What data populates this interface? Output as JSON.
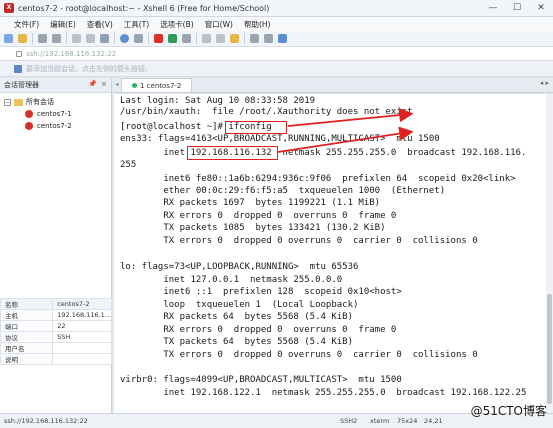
{
  "window": {
    "title": "centos7-2 - root@localhost:~ - Xshell 6 (Free for Home/School)",
    "icon_label": "X",
    "controls": [
      "—",
      "☐",
      "✕"
    ]
  },
  "menu": [
    "文件(F)",
    "编辑(E)",
    "查看(V)",
    "工具(T)",
    "选项卡(B)",
    "窗口(W)",
    "帮助(H)"
  ],
  "address": {
    "value": "ssh://192.168.116.132:22"
  },
  "hint": {
    "text": "要添加当前会话，点击左侧的箭头按钮。"
  },
  "session_manager": {
    "header": "会话管理器",
    "pin_icon": "📌",
    "close_icon": "×",
    "root_label": "所有会话",
    "expander": "−",
    "sessions": [
      {
        "label": "centos7-1"
      },
      {
        "label": "centos7-2"
      }
    ]
  },
  "properties": {
    "header_key": "名称",
    "header_value": "centos7-2",
    "rows": [
      {
        "key": "主机",
        "value": "192.168.116.1..."
      },
      {
        "key": "端口",
        "value": "22"
      },
      {
        "key": "协议",
        "value": "SSH"
      },
      {
        "key": "用户名",
        "value": ""
      },
      {
        "key": "说明",
        "value": ""
      }
    ]
  },
  "tabs": [
    {
      "label": "1 centos7-2"
    }
  ],
  "tab_nav_left": "◂",
  "tab_nav_right": "◂ ▸",
  "terminal": {
    "lines": [
      "Last login: Sat Aug 10 08:33:58 2019",
      "/usr/bin/xauth:  file /root/.Xauthority does not exist",
      "[root@localhost ~]# ifconfig",
      "ens33: flags=4163<UP,BROADCAST,RUNNING,MULTICAST>  mtu 1500",
      "        inet 192.168.116.132  netmask 255.255.255.0  broadcast 192.168.116.",
      "255",
      "        inet6 fe80::1a6b:6294:936c:9f06  prefixlen 64  scopeid 0x20<link>",
      "        ether 00:0c:29:f6:f5:a5  txqueuelen 1000  (Ethernet)",
      "        RX packets 1697  bytes 1199221 (1.1 MiB)",
      "        RX errors 0  dropped 0  overruns 0  frame 0",
      "        TX packets 1085  bytes 133421 (130.2 KiB)",
      "        TX errors 0  dropped 0 overruns 0  carrier 0  collisions 0",
      "",
      "lo: flags=73<UP,LOOPBACK,RUNNING>  mtu 65536",
      "        inet 127.0.0.1  netmask 255.0.0.0",
      "        inet6 ::1  prefixlen 128  scopeid 0x10<host>",
      "        loop  txqueuelen 1  (Local Loopback)",
      "        RX packets 64  bytes 5568 (5.4 KiB)",
      "        RX errors 0  dropped 0  overruns 0  frame 0",
      "        TX packets 64  bytes 5568 (5.4 KiB)",
      "        TX errors 0  dropped 0 overruns 0  carrier 0  collisions 0",
      "",
      "virbr0: flags=4099<UP,BROADCAST,MULTICAST>  mtu 1500",
      "        inet 192.168.122.1  netmask 255.255.255.0  broadcast 192.168.122.25"
    ]
  },
  "status": {
    "connection": "ssh://192.168.116.132:22",
    "protocol": "SSH2",
    "terminal": "xterm",
    "size": "75x24",
    "cursor": "24,21"
  },
  "watermark": "@51CTO博客",
  "colors": {
    "highlight": "#e02020",
    "session": "#d8312c",
    "connected": "#2db36b"
  }
}
